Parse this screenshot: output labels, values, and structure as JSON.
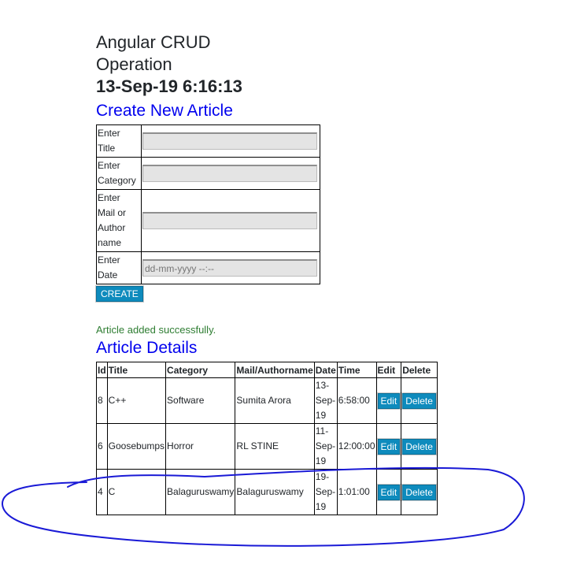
{
  "header": {
    "title_line1": "Angular CRUD",
    "title_line2": "Operation",
    "clock": "13-Sep-19 6:16:13"
  },
  "create_section": {
    "title": "Create New Article",
    "fields": [
      {
        "label_lines": [
          "Enter",
          "Title"
        ],
        "value": ""
      },
      {
        "label_lines": [
          "Enter",
          "Category"
        ],
        "value": ""
      },
      {
        "label_lines": [
          "Enter",
          "Mail or",
          "Author",
          "name"
        ],
        "value": ""
      },
      {
        "label_lines": [
          "Enter",
          "Date"
        ],
        "placeholder": "dd-mm-yyyy --:--"
      }
    ],
    "create_label": "CREATE"
  },
  "status_message": "Article added successfully.",
  "details_section": {
    "title": "Article Details",
    "columns": [
      "Id",
      "Title",
      "Category",
      "Mail/Authorname",
      "Date",
      "Time",
      "Edit",
      "Delete"
    ],
    "rows": [
      {
        "id": "8",
        "title": "C++",
        "category": "Software",
        "author": "Sumita Arora",
        "date_lines": [
          "13-",
          "Sep-",
          "19"
        ],
        "time": "6:58:00",
        "edit": "Edit",
        "delete": "Delete"
      },
      {
        "id": "6",
        "title": "Goosebumps",
        "category": "Horror",
        "author": "RL STINE",
        "date_lines": [
          "11-",
          "Sep-",
          "19"
        ],
        "time": "12:00:00",
        "edit": "Edit",
        "delete": "Delete"
      },
      {
        "id": "4",
        "title": "C",
        "category": "Balaguruswamy",
        "author": "Balaguruswamy",
        "date_lines": [
          "19-",
          "Sep-",
          "19"
        ],
        "time": "1:01:00",
        "edit": "Edit",
        "delete": "Delete"
      }
    ]
  },
  "annotation_color": "#1a1ad6"
}
